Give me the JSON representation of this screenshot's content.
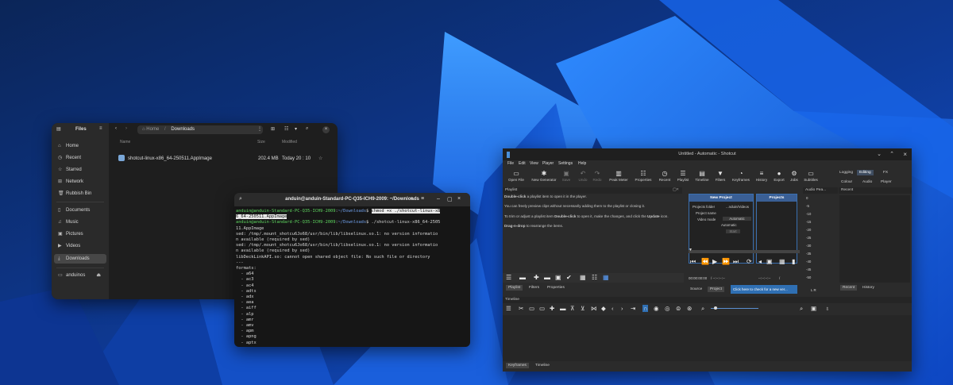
{
  "files": {
    "sidebar_title": "Files",
    "items": [
      {
        "icon": "home-icon",
        "label": "Home"
      },
      {
        "icon": "clock-icon",
        "label": "Recent"
      },
      {
        "icon": "star-icon",
        "label": "Starred"
      },
      {
        "icon": "network-icon",
        "label": "Network"
      },
      {
        "icon": "trash-icon",
        "label": "Rubbish Bin"
      },
      {
        "icon": "document-icon",
        "label": "Documents"
      },
      {
        "icon": "music-icon",
        "label": "Music"
      },
      {
        "icon": "picture-icon",
        "label": "Pictures"
      },
      {
        "icon": "video-icon",
        "label": "Videos"
      },
      {
        "icon": "download-icon",
        "label": "Downloads"
      },
      {
        "icon": "drive-icon",
        "label": "anduinos"
      }
    ],
    "selected": "Downloads",
    "path": [
      "Home",
      "Downloads"
    ],
    "columns": {
      "name": "Name",
      "size": "Size",
      "modified": "Modified"
    },
    "file": {
      "name": "shotcut-linux-x86_64-250511.AppImage",
      "size": "202.4 MB",
      "modified": "Today 20 : 10"
    }
  },
  "terminal": {
    "title": "anduin@anduin-Standard-PC-Q35-ICH9-2009: ~/Downloads",
    "prompt_user": "anduin@anduin-Standard-PC-Q35-ICH9-2009",
    "prompt_dir": "~/Downloads",
    "cmd1a": "chmod +x ./shotcut-linux-x8",
    "cmd1b": "6_64-250511.AppImage",
    "cmd2a": "./shotcut-linux-x86_64-2505",
    "cmd2b": "11.AppImage",
    "lines": [
      "sed: /tmp/.mount_shotcu6Jo68/usr/bin/lib/libselinux.so.1: no version informatio",
      "n available (required by sed)",
      "sed: /tmp/.mount_shotcu6Jo68/usr/bin/lib/libselinux.so.1: no version informatio",
      "n available (required by sed)",
      "libDeckLinkAPI.so: cannot open shared object file: No such file or directory",
      "---",
      "formats:",
      "  - a64",
      "  - ac3",
      "  - ac4",
      "  - adts",
      "  - adx",
      "  - aea",
      "  - aiff",
      "  - alp",
      "  - amr",
      "  - amv",
      "  - apm",
      "  - apng",
      "  - aptx"
    ]
  },
  "shotcut": {
    "title": "Untitled - Automatic - Shotcut",
    "menu": [
      "File",
      "Edit",
      "View",
      "Player",
      "Settings",
      "Help"
    ],
    "toolbar": [
      {
        "label": "Open File",
        "icon": "folder-icon",
        "glyph": "▭",
        "enabled": true
      },
      {
        "label": "New Generator",
        "icon": "generator-icon",
        "glyph": "✱",
        "enabled": true
      },
      {
        "label": "Save",
        "icon": "save-icon",
        "glyph": "▣",
        "enabled": false
      },
      {
        "label": "Undo",
        "icon": "undo-icon",
        "glyph": "↶",
        "enabled": false
      },
      {
        "label": "Redo",
        "icon": "redo-icon",
        "glyph": "↷",
        "enabled": false
      },
      {
        "label": "Peak Meter",
        "icon": "peak-meter-icon",
        "glyph": "▥",
        "enabled": true
      },
      {
        "label": "Properties",
        "icon": "properties-icon",
        "glyph": "☷",
        "enabled": true
      },
      {
        "label": "Recent",
        "icon": "recent-icon",
        "glyph": "◷",
        "enabled": true
      },
      {
        "label": "Playlist",
        "icon": "playlist-icon",
        "glyph": "☰",
        "enabled": true
      },
      {
        "label": "Timeline",
        "icon": "timeline-icon",
        "glyph": "▤",
        "enabled": true
      },
      {
        "label": "Filters",
        "icon": "filter-icon",
        "glyph": "▼",
        "enabled": true
      },
      {
        "label": "Keyframes",
        "icon": "keyframes-icon",
        "glyph": "◔",
        "enabled": true
      },
      {
        "label": "History",
        "icon": "history-icon",
        "glyph": "≡",
        "enabled": true
      },
      {
        "label": "Export",
        "icon": "export-icon",
        "glyph": "●",
        "enabled": true
      },
      {
        "label": "Jobs",
        "icon": "jobs-icon",
        "glyph": "⚙",
        "enabled": true
      },
      {
        "label": "Subtitles",
        "icon": "subtitles-icon",
        "glyph": "▭",
        "enabled": true
      }
    ],
    "modes_top": [
      "Logging",
      "Editing",
      "FX"
    ],
    "modes_bottom": [
      "Colour",
      "Audio",
      "Player"
    ],
    "active_mode": "Editing",
    "playlist": {
      "header": "Playlist",
      "p1b": "Double-click",
      "p1": " a playlist item to open it in the player.",
      "p2": "You can freely preview clips without necessarily adding them to the playlist or closing it.",
      "p3a": "To trim or adjust a playlist item ",
      "p3b": "Double-click",
      "p3c": " to open it, make the changes, and click the ",
      "p3d": "Update",
      "p3e": " icon.",
      "p4b": "Drag-n-drop",
      "p4": " to rearrange the items.",
      "tabs": [
        "Playlist",
        "Filters",
        "Properties"
      ]
    },
    "new_project": {
      "title": "New Project",
      "folder_label": "Projects folder",
      "folder_value": "...nduin/Videos",
      "name_label": "Project name",
      "mode_label": "Video mode",
      "mode_value": "Automatic",
      "mode_value2": "Automatic",
      "start": "Start"
    },
    "projects": {
      "title": "Projects"
    },
    "player": {
      "timecode": "00:00:00:00",
      "duration": "/ --:--:--:--",
      "in_out": "--:--:--:--",
      "zoom": "/",
      "tabs": [
        "Source",
        "Project"
      ],
      "update_msg": "Click here to check for a new ver..."
    },
    "audio": {
      "header": "Audio Pea...",
      "scale": [
        "0",
        "-5",
        "-10",
        "-15",
        "-20",
        "-25",
        "-30",
        "-35",
        "-40",
        "-45",
        "-50"
      ],
      "lr": "L  R"
    },
    "recent": {
      "header": "Recent",
      "tabs": [
        "Recent",
        "History"
      ]
    },
    "timeline": {
      "header": "Timeline"
    },
    "bottom_tabs": [
      "Keyframes",
      "Timeline"
    ]
  }
}
